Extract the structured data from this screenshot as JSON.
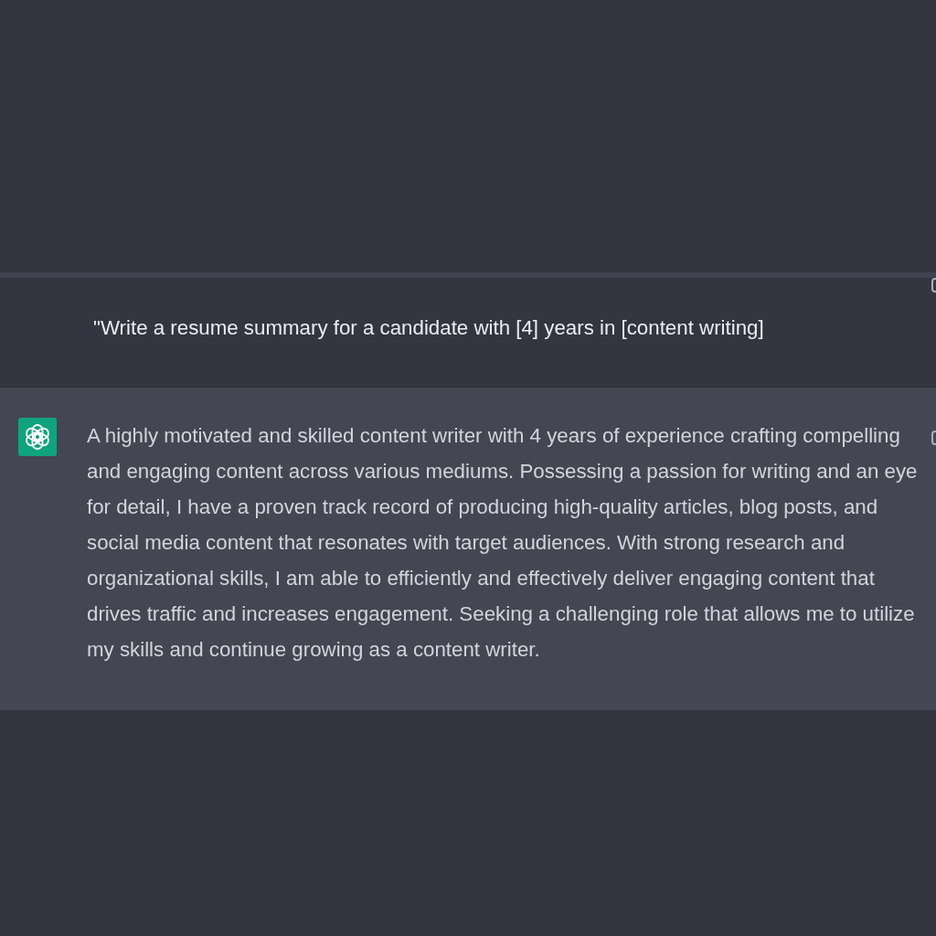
{
  "conversation": [
    {
      "kind": "user",
      "text": "\"Write a resume summary for a candidate with [4] years in [content writing]"
    },
    {
      "kind": "assistant",
      "text": "A highly motivated and skilled content writer with 4 years of experience crafting compelling and engaging content across various mediums. Possessing a passion for writing and an eye for detail, I have a proven track record of producing high-quality articles, blog posts, and social media content that resonates with target audiences. With strong research and organizational skills, I am able to efficiently and effectively deliver engaging content that drives traffic and increases engagement. Seeking a challenging role that allows me to utilize my skills and continue growing as a content writer."
    }
  ]
}
